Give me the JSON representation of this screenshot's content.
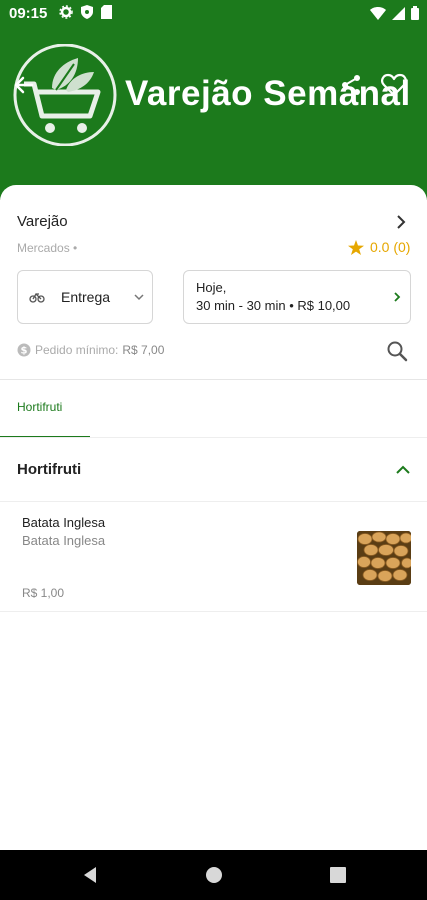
{
  "status_bar": {
    "time": "09:15",
    "left_icons": [
      "settings-icon",
      "shield-icon",
      "sim-card-icon"
    ],
    "right_icons": [
      "wifi-icon",
      "signal-icon",
      "battery-icon"
    ]
  },
  "header": {
    "brand_name": "Varejão Semanal",
    "logo_icon": "shopping-cart-leaf-logo",
    "back_icon": "back-arrow-icon",
    "share_icon": "share-icon",
    "favorite_icon": "heart-outline-icon",
    "background_color": "#1c7a1c"
  },
  "store": {
    "name": "Varejão",
    "category": "Mercados •",
    "rating": "0.0 (0)",
    "rating_color": "#e6a700"
  },
  "delivery": {
    "mode": "Entrega",
    "mode_icon": "bike-icon"
  },
  "schedule": {
    "line1": "Hoje,",
    "line2": "30 min - 30 min • R$ 10,00"
  },
  "minimum_order": {
    "label": "Pedido mínimo:",
    "value": "R$ 7,00"
  },
  "tabs": [
    {
      "label": "Hortifruti",
      "active": true
    }
  ],
  "section": {
    "title": "Hortifruti",
    "expanded": true
  },
  "products": [
    {
      "name": "Batata Inglesa",
      "description": "Batata Inglesa",
      "price": "R$ 1,00",
      "image": "potatoes-photo"
    }
  ],
  "system_nav": [
    "back-triangle-icon",
    "home-circle-icon",
    "recents-square-icon"
  ],
  "accent_color": "#1c7a1c"
}
